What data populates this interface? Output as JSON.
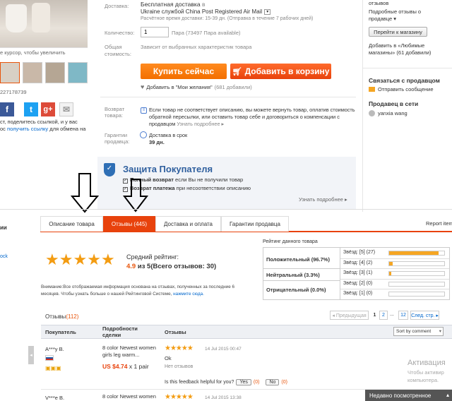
{
  "left": {
    "zoom_hint": "е курсор, чтобы увеличить",
    "item_id": "227178739",
    "share_text_1": "ст, поделитесь ссылкой, и у вас",
    "share_text_2_prefix": "ос ",
    "share_text_2_link": "получить ссылку",
    "share_text_2_suffix": " для обмена на",
    "social": [
      {
        "name": "facebook",
        "glyph": "f",
        "color": "#3b5998"
      },
      {
        "name": "twitter",
        "glyph": "t",
        "color": "#1da1f2"
      },
      {
        "name": "google-plus",
        "glyph": "g+",
        "color": "#dd4b39"
      },
      {
        "name": "mail",
        "glyph": "✉",
        "color": "#d9d9d9"
      }
    ]
  },
  "delivery": {
    "label": "Доставка:",
    "free": "Бесплатная доставка",
    "to": "в",
    "service": "Ukraine службой China Post Registered Air Mail",
    "estimate": "Расчётное время доставки: 15-39 дн. (Отправка в течение 7 рабочих дней)"
  },
  "quantity": {
    "label": "Количество:",
    "value": "1",
    "available": "Пара (73497 Пара available)"
  },
  "total": {
    "label_1": "Общая",
    "label_2": "стоимость:",
    "text": "Зависит от выбранных характеристик товара"
  },
  "buttons": {
    "buy_now": "Купить сейчас",
    "add_to_cart": "Добавить в корзину",
    "wishlist": "Добавить в \"Мои желания\"",
    "wishlist_count": "(681 добавили)"
  },
  "returns": {
    "label_1": "Возврат",
    "label_2": "товара:",
    "text_1": "Если товар не соответствует описанию, вы можете вернуть товар, оплатив стоимость",
    "text_2": "обратной пересылки, или оставить товар себе и договориться о компенсации с",
    "text_3": "продавцом",
    "more": "Узнать подробнее ▸"
  },
  "guarantee": {
    "label_1": "Гарантии",
    "label_2": "продавца:",
    "line_1": "Доставка в срок",
    "line_2": "39 дн."
  },
  "protection": {
    "title": "Защита Покупателя",
    "line_1_bold": "Полный возврат",
    "line_1_rest": "если Вы не получили товар",
    "line_2_bold": "Возврат платежа",
    "line_2_rest": "при несоответствии описанию",
    "more": "Узнать подробнее ▸"
  },
  "right": {
    "reviews_word": "отзывов",
    "detailed": "Подробные отзывы о",
    "seller": "продавце ▾",
    "go_store": "Перейти к магазину",
    "add_fav_1": "Добавить в «Любимые",
    "add_fav_2": "магазины» (61 добавили)",
    "contact_title": "Связаться с продавцом",
    "send_msg": "Отправить сообщение",
    "network_title": "Продавец в сети",
    "seller_name": "yanxia wang"
  },
  "tabs": [
    {
      "label": "Описание товара"
    },
    {
      "label": "Отзывы (445)"
    },
    {
      "label": "Доставка и оплата"
    },
    {
      "label": "Гарантии продавца"
    }
  ],
  "report": "Report item",
  "sidebar_left": {
    "line_1": "ии",
    "line_2": "ock"
  },
  "rating": {
    "avg_label": "Средний рейтинг:",
    "avg_value": "4.9",
    "avg_rest": "из 5(Всего отзывов: 30)",
    "note_1": "Внимание:Все отображаемая информация основана на отзывах, полученных за последние 6",
    "note_2": "месяцев. Чтобы узнать больше о нашей Рейтинговой Системе,",
    "note_link": "нажмите сюда.",
    "table_title": "Рейтинг данного товара",
    "positive": "Положительный (96.7%)",
    "neutral": "Нейтральный (3.3%)",
    "negative": "Отрицательный (0.0%)",
    "stars": [
      {
        "label": "Звёзд: [5]",
        "count": "(27)",
        "fraction": 0.9
      },
      {
        "label": "Звёзд: [4]",
        "count": "(2)",
        "fraction": 0.067
      },
      {
        "label": "Звёзд: [3]",
        "count": "(1)",
        "fraction": 0.033
      },
      {
        "label": "Звёзд: [2]",
        "count": "(0)",
        "fraction": 0
      },
      {
        "label": "Звёзд: [1]",
        "count": "(0)",
        "fraction": 0
      }
    ]
  },
  "reviews": {
    "title": "Отзывы",
    "count": "(112)",
    "pagination": {
      "prev": "◂ Предыдущая",
      "p1": "1",
      "p2": "2",
      "dots": "...",
      "p12": "12",
      "next": "След. стр. ▸"
    },
    "col_buyer": "Покупатель",
    "col_details_1": "Подробности",
    "col_details_2": "сделки",
    "col_reviews": "Отзывы",
    "sort": "Sort by comment",
    "items": [
      {
        "buyer": "A***y B.",
        "product_1": "8 color Newest women",
        "product_2": "girls leg warm...",
        "price": "US $4.74",
        "qty": "x 1 pair",
        "date": "14 Jul 2015 00:47",
        "comment": "Ok",
        "reply": "Нет отзывов",
        "helpful": "Is this feedback helpful for you?",
        "yes": "Yes",
        "yes_count": "(0)",
        "no": "No",
        "no_count": "(0)"
      },
      {
        "buyer": "V***e B.",
        "product_1": "8 color Newest women",
        "date": "14 Jul 2015 13:38"
      }
    ]
  },
  "windows": {
    "activation_1": "Активация",
    "activation_2": "Чтобы активир",
    "activation_3": "компьютера.",
    "recent": "Недавно посмотренное"
  }
}
